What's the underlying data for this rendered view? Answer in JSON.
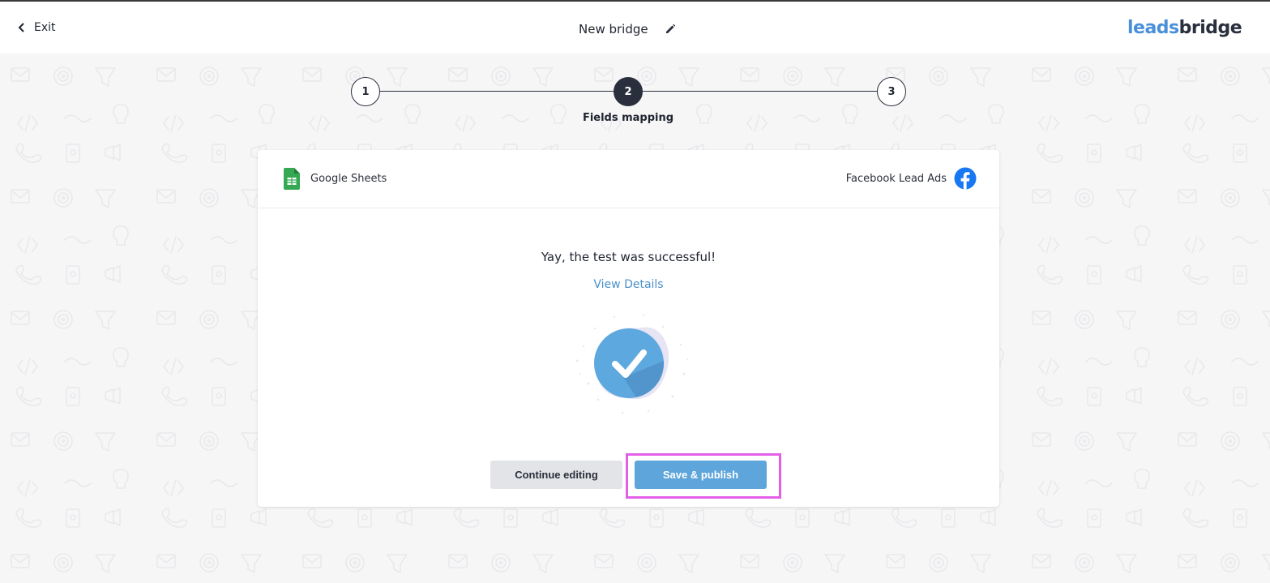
{
  "header": {
    "exit_label": "Exit",
    "title": "New bridge",
    "logo": {
      "part1": "leads",
      "part2": "bridge"
    }
  },
  "stepper": {
    "steps": [
      {
        "number": "1",
        "state": "inactive"
      },
      {
        "number": "2",
        "state": "active"
      },
      {
        "number": "3",
        "state": "inactive"
      }
    ],
    "active_label": "Fields mapping"
  },
  "card": {
    "source": {
      "name": "Google Sheets",
      "icon": "google-sheets-icon"
    },
    "destination": {
      "name": "Facebook Lead Ads",
      "icon": "facebook-icon"
    },
    "message": "Yay, the test was successful!",
    "details_link": "View Details",
    "status_icon": "success-check-icon"
  },
  "actions": {
    "continue_label": "Continue editing",
    "save_label": "Save & publish"
  },
  "colors": {
    "accent": "#5ea5dc",
    "dark": "#2a2f3d",
    "highlight": "#e35fe8",
    "link": "#4a90c9"
  }
}
